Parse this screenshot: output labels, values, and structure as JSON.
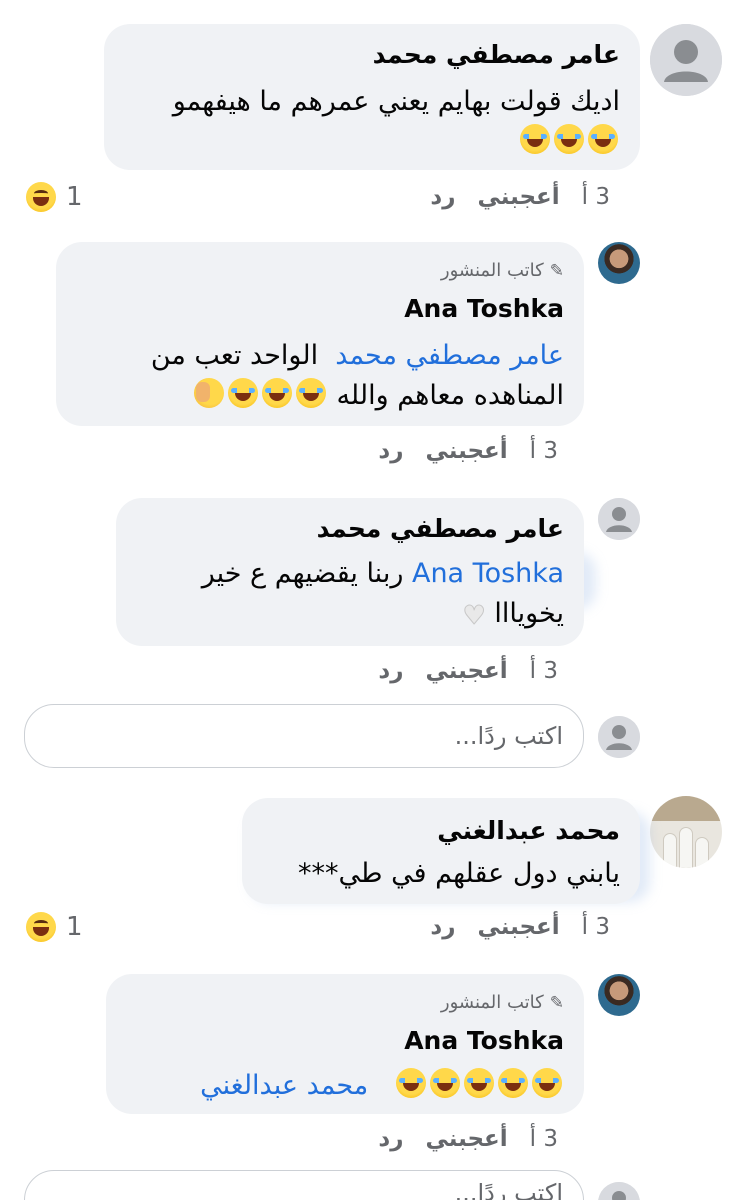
{
  "comments": [
    {
      "name": "عامر مصطفي محمد",
      "text_line1": "اديك قولت بهايم يعني عمرهم ما هيفهمو",
      "time": "3 أ",
      "like": "أعجبني",
      "reply": "رد",
      "reaction_count": "1"
    },
    {
      "author_tag": "كاتب المنشور",
      "name": "Ana Toshka",
      "mention": "عامر مصطفي محمد",
      "text_line1": "الواحد تعب من",
      "text_line2": "المناهده معاهم والله",
      "time": "3 أ",
      "like": "أعجبني",
      "reply": "رد"
    },
    {
      "name": "عامر مصطفي محمد",
      "mention": "Ana Toshka",
      "text_line1": "ربنا يقضيهم ع خير",
      "text_line2": "يخويااا",
      "time": "3 أ",
      "like": "أعجبني",
      "reply": "رد"
    },
    {
      "name": "محمد عبدالغني",
      "text_line1": "يابني دول عقلهم في طي***",
      "time": "3 أ",
      "like": "أعجبني",
      "reply": "رد",
      "reaction_count": "1"
    },
    {
      "author_tag": "كاتب المنشور",
      "name": "Ana Toshka",
      "mention": "محمد عبدالغني",
      "time": "3 أ",
      "like": "أعجبني",
      "reply": "رد"
    }
  ],
  "reply_input": {
    "placeholder": "اكتب ردًا..."
  },
  "colors": {
    "bubble": "#f0f2f5",
    "mention": "#216fdb",
    "meta": "#65676b"
  }
}
